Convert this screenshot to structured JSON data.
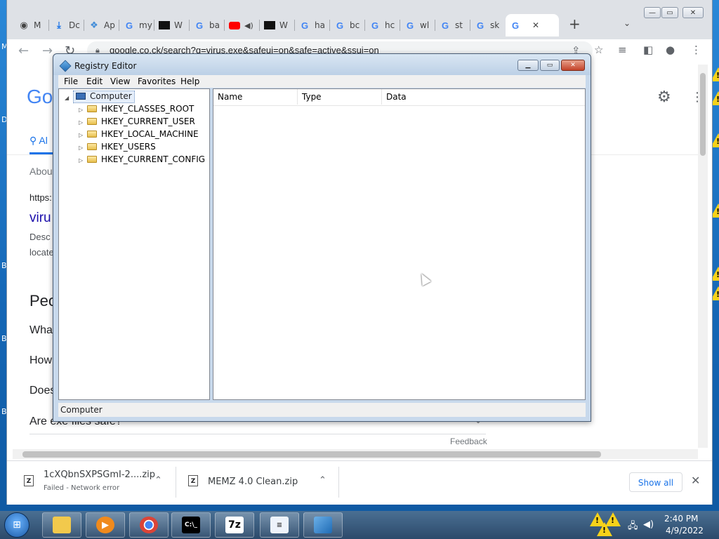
{
  "chrome": {
    "tabs": [
      {
        "icon": "github-icon",
        "title": "M"
      },
      {
        "icon": "download-icon",
        "title": "Dc"
      },
      {
        "icon": "apps-icon",
        "title": "Ap"
      },
      {
        "icon": "google-icon",
        "title": "my"
      },
      {
        "icon": "terminal-icon",
        "title": "W"
      },
      {
        "icon": "google-icon",
        "title": "ba"
      },
      {
        "icon": "youtube-icon",
        "title": ""
      },
      {
        "icon": "terminal-icon",
        "title": "W"
      },
      {
        "icon": "google-icon",
        "title": "ha"
      },
      {
        "icon": "google-icon",
        "title": "bc"
      },
      {
        "icon": "google-icon",
        "title": "hc"
      },
      {
        "icon": "google-icon",
        "title": "wl"
      },
      {
        "icon": "google-icon",
        "title": "st"
      },
      {
        "icon": "google-icon",
        "title": "sk"
      },
      {
        "icon": "google-icon",
        "title": ""
      }
    ],
    "new_tab": "+",
    "url": "google.co.ck/search?q=virus.exe&safeui=on&safe=active&ssui=on"
  },
  "google_page": {
    "logo_partial": "Go",
    "all_tab": "Al",
    "about": "About",
    "result_url": "https:",
    "result_title": "viru",
    "desc_line1": "Desc",
    "desc_line2": "locate",
    "people_heading": "Peo",
    "questions": [
      "Wha",
      "How",
      "Does",
      "Are exe files safe?"
    ],
    "feedback": "Feedback"
  },
  "downloads": [
    {
      "name": "1cXQbnSXPSGmI-2....zip",
      "status": "Failed - Network error"
    },
    {
      "name": "MEMZ 4.0 Clean.zip",
      "status": ""
    }
  ],
  "show_all": "Show all",
  "regedit": {
    "title": "Registry Editor",
    "menu": [
      "File",
      "Edit",
      "View",
      "Favorites",
      "Help"
    ],
    "root": "Computer",
    "keys": [
      "HKEY_CLASSES_ROOT",
      "HKEY_CURRENT_USER",
      "HKEY_LOCAL_MACHINE",
      "HKEY_USERS",
      "HKEY_CURRENT_CONFIG"
    ],
    "columns": [
      "Name",
      "Type",
      "Data"
    ],
    "status": "Computer"
  },
  "taskbar": {
    "apps": [
      "explorer-icon",
      "media-player-icon",
      "chrome-icon",
      "cmd-icon",
      "7zip-icon",
      "notepad-icon",
      "regedit-icon"
    ],
    "time": "2:40 PM",
    "date": "4/9/2022"
  },
  "desktop_letters": [
    "M",
    "D",
    "B",
    "B",
    "B"
  ]
}
